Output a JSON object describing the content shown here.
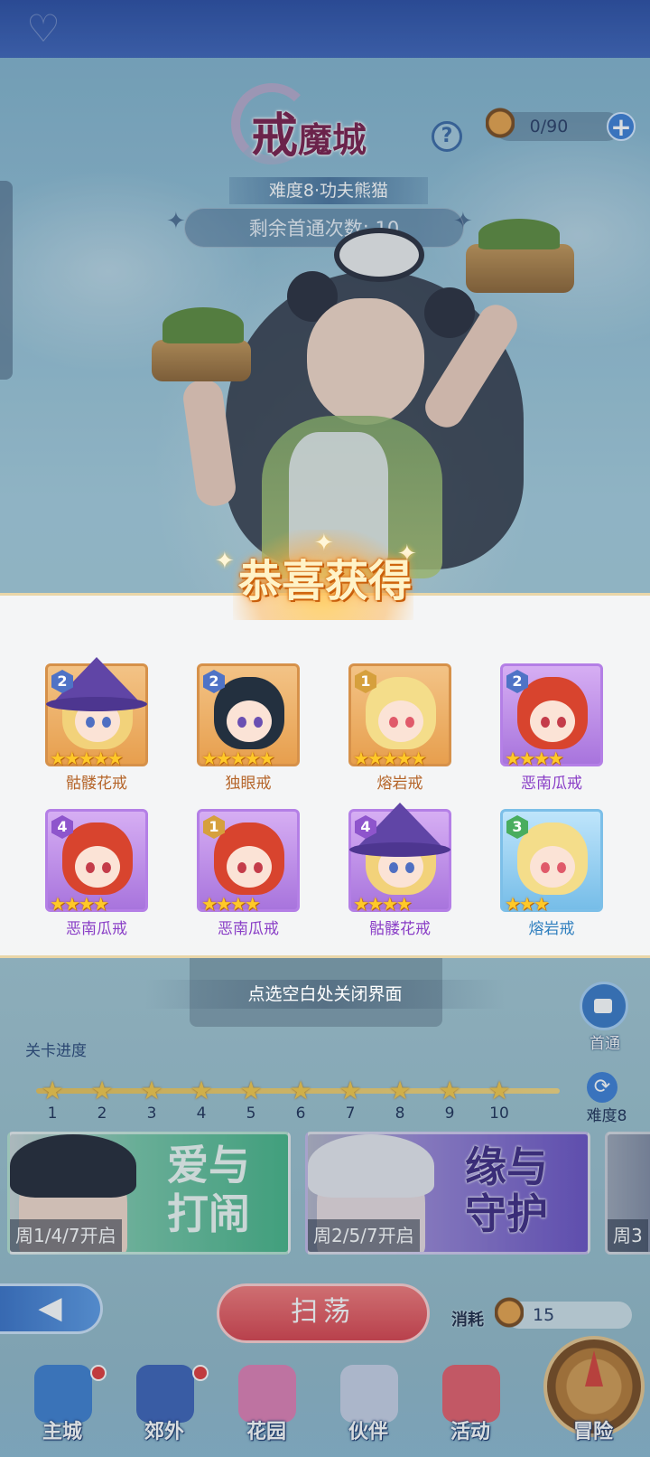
{
  "header": {
    "title_big": "戒",
    "title_rest": "魔城",
    "help_symbol": "?",
    "ticket_count": "0/90",
    "ticket_plus": "+",
    "difficulty_banner": "难度8·功夫熊猫",
    "first_clear_text": "剩余首通次数: 10"
  },
  "reward": {
    "title": "恭喜获得",
    "items": [
      {
        "name": "骷髅花戒",
        "level": "2",
        "stars": "★★★★★",
        "frame": "orange",
        "hair": "#f2d27a",
        "hat": true,
        "eye": "#4f6fc2"
      },
      {
        "name": "独眼戒",
        "level": "2",
        "stars": "★★★★★",
        "frame": "orange",
        "hair": "#23303f",
        "hat": false,
        "eye": "#6a4fb2"
      },
      {
        "name": "熔岩戒",
        "level": "1",
        "stars": "★★★★★",
        "frame": "orange",
        "hair": "#f4dd8a",
        "hat": false,
        "eye": "#e05a6a"
      },
      {
        "name": "恶南瓜戒",
        "level": "2",
        "stars": "★★★★",
        "frame": "purple",
        "hair": "#d8442e",
        "hat": false,
        "eye": "#c43c4a"
      },
      {
        "name": "恶南瓜戒",
        "level": "4",
        "stars": "★★★★",
        "frame": "purple",
        "hair": "#d8442e",
        "hat": false,
        "eye": "#c43c4a"
      },
      {
        "name": "恶南瓜戒",
        "level": "1",
        "stars": "★★★★",
        "frame": "purple",
        "hair": "#d8442e",
        "hat": false,
        "eye": "#c43c4a"
      },
      {
        "name": "骷髅花戒",
        "level": "4",
        "stars": "★★★★",
        "frame": "purple",
        "hair": "#f2d27a",
        "hat": true,
        "eye": "#4f6fc2"
      },
      {
        "name": "熔岩戒",
        "level": "3",
        "stars": "★★★",
        "frame": "blue",
        "hair": "#f4dd8a",
        "hat": false,
        "eye": "#e05a6a"
      }
    ],
    "close_hint": "点选空白处关闭界面"
  },
  "record": {
    "label": "首通"
  },
  "progress": {
    "label": "关卡进度",
    "nodes": [
      "1",
      "2",
      "3",
      "4",
      "5",
      "6",
      "7",
      "8",
      "9",
      "10"
    ],
    "difficulty_label": "难度8"
  },
  "events": [
    {
      "title_1": "爱与",
      "title_2": "打闹",
      "schedule": "周1/4/7开启"
    },
    {
      "title_1": "缘与",
      "title_2": "守护",
      "schedule": "周2/5/7开启"
    },
    {
      "schedule": "周3"
    }
  ],
  "actions": {
    "back_symbol": "◀",
    "sweep_label": "扫荡",
    "cost_label": "消耗",
    "cost_value": "15"
  },
  "nav": {
    "items": [
      {
        "label": "主城",
        "color": "#3f7fd0",
        "dot": true
      },
      {
        "label": "郊外",
        "color": "#3e63b8",
        "dot": true
      },
      {
        "label": "花园",
        "color": "#e07fb4",
        "dot": false
      },
      {
        "label": "伙伴",
        "color": "#c9d1e6",
        "dot": false
      },
      {
        "label": "活动",
        "color": "#e55f6b",
        "dot": false
      }
    ],
    "adventure_label": "冒险"
  }
}
